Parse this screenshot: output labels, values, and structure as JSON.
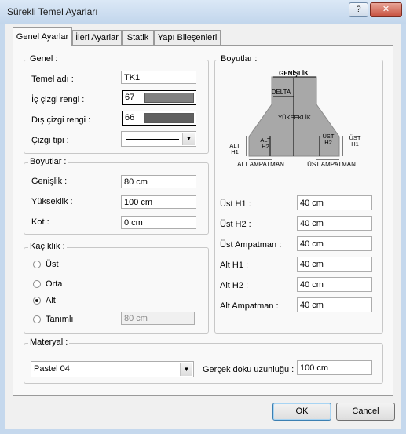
{
  "window": {
    "title": "Sürekli Temel Ayarları",
    "help_label": "?",
    "close_label": "✕"
  },
  "tabs": [
    {
      "label": "Genel Ayarlar",
      "active": true
    },
    {
      "label": "İleri Ayarlar",
      "active": false
    },
    {
      "label": "Statik",
      "active": false
    },
    {
      "label": "Yapı Bileşenleri",
      "active": false
    }
  ],
  "genel": {
    "title": "Genel :",
    "name_label": "Temel adı :",
    "name_value": "TK1",
    "inner_color_label": "İç çizgi rengi :",
    "inner_color_value": "67",
    "inner_color_hex": "#808080",
    "outer_color_label": "Dış çizgi rengi :",
    "outer_color_value": "66",
    "outer_color_hex": "#606060",
    "line_type_label": "Çizgi tipi :"
  },
  "boyutlar_left": {
    "title": "Boyutlar :",
    "width_label": "Genişlik :",
    "width_value": "80 cm",
    "height_label": "Yükseklik :",
    "height_value": "100 cm",
    "kot_label": "Kot :",
    "kot_value": "0 cm"
  },
  "kaciklik": {
    "title": "Kaçıklık :",
    "options": [
      {
        "label": "Üst",
        "checked": false
      },
      {
        "label": "Orta",
        "checked": false
      },
      {
        "label": "Alt",
        "checked": true
      },
      {
        "label": "Tanımlı",
        "checked": false
      }
    ],
    "custom_value": "80 cm"
  },
  "boyutlar_right": {
    "title": "Boyutlar :",
    "diagram": {
      "genislik": "GENİŞLİK",
      "delta": "DELTA",
      "yukseklik": "YÜKSEKLİK",
      "alt_h1": [
        "ALT",
        "H1"
      ],
      "alt_h2": [
        "ALT",
        "H2"
      ],
      "ust_h2": [
        "ÜST",
        "H2"
      ],
      "ust_h1": [
        "ÜST",
        "H1"
      ],
      "alt_ampatman": "ALT AMPATMAN",
      "ust_ampatman": "ÜST AMPATMAN"
    },
    "fields": [
      {
        "label": "Üst H1 :",
        "value": "40 cm"
      },
      {
        "label": "Üst H2 :",
        "value": "40 cm"
      },
      {
        "label": "Üst Ampatman :",
        "value": "40 cm"
      },
      {
        "label": "Alt H1 :",
        "value": "40 cm"
      },
      {
        "label": "Alt H2 :",
        "value": "40 cm"
      },
      {
        "label": "Alt Ampatman :",
        "value": "40 cm"
      }
    ]
  },
  "materyal": {
    "title": "Materyal :",
    "selected": "Pastel 04",
    "texture_label": "Gerçek doku uzunluğu :",
    "texture_value": "100 cm"
  },
  "buttons": {
    "ok": "OK",
    "cancel": "Cancel"
  }
}
